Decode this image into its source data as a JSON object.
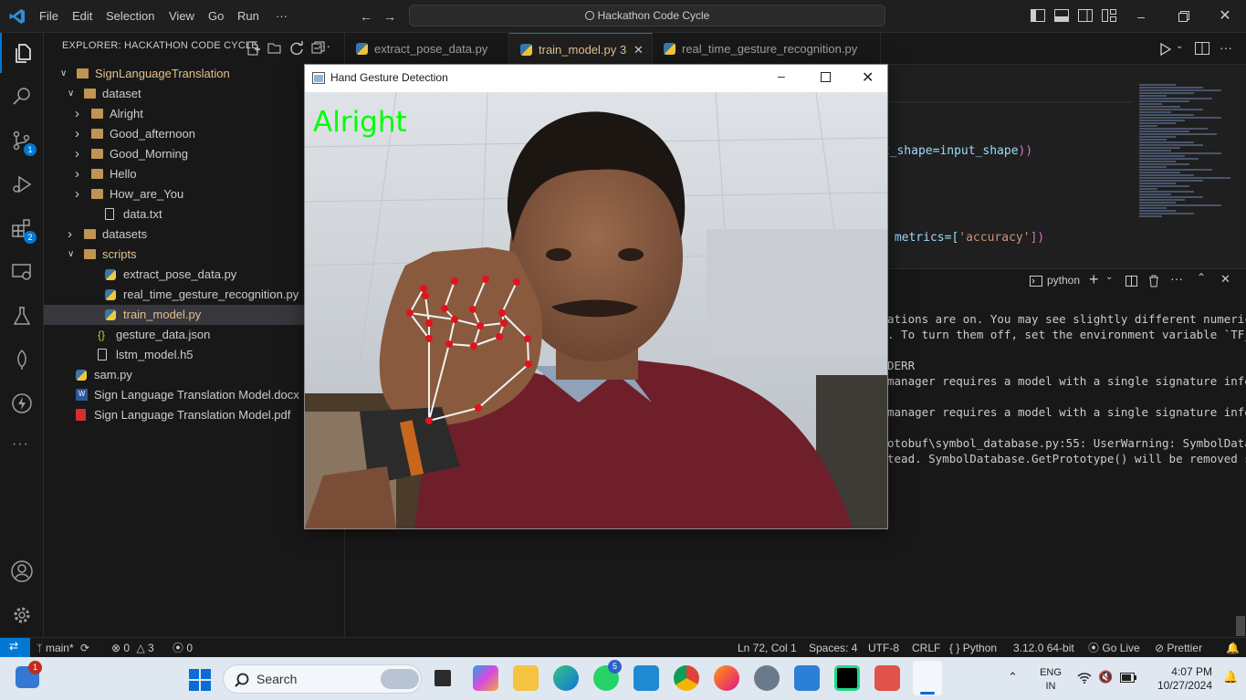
{
  "titlebar": {
    "menus": [
      "File",
      "Edit",
      "Selection",
      "View",
      "Go",
      "Run",
      "···"
    ],
    "command_center": "Hackathon Code Cycle"
  },
  "activitybar": {
    "scm_badge": "1",
    "extensions_badge": "2"
  },
  "sidebar": {
    "title": "EXPLORER: HACKATHON CODE CYCLE",
    "items": [
      {
        "label": "SignLanguageTranslation",
        "kind": "folder-open"
      },
      {
        "label": "dataset",
        "kind": "folder-open"
      },
      {
        "label": "Alright",
        "kind": "folder"
      },
      {
        "label": "Good_afternoon",
        "kind": "folder"
      },
      {
        "label": "Good_Morning",
        "kind": "folder"
      },
      {
        "label": "Hello",
        "kind": "folder"
      },
      {
        "label": "How_are_You",
        "kind": "folder"
      },
      {
        "label": "data.txt",
        "kind": "txt"
      },
      {
        "label": "datasets",
        "kind": "folder"
      },
      {
        "label": "scripts",
        "kind": "folder-open"
      },
      {
        "label": "extract_pose_data.py",
        "kind": "py"
      },
      {
        "label": "real_time_gesture_recognition.py",
        "kind": "py"
      },
      {
        "label": "train_model.py",
        "kind": "py"
      },
      {
        "label": "gesture_data.json",
        "kind": "json"
      },
      {
        "label": "lstm_model.h5",
        "kind": "txt"
      },
      {
        "label": "sam.py",
        "kind": "py"
      },
      {
        "label": "Sign Language Translation Model.docx",
        "kind": "docx"
      },
      {
        "label": "Sign Language Translation Model.pdf",
        "kind": "pdf"
      }
    ]
  },
  "tabs": [
    {
      "label": "extract_pose_data.py",
      "active": false
    },
    {
      "label": "train_model.py",
      "active": true,
      "problems": "3"
    },
    {
      "label": "real_time_gesture_recognition.py",
      "active": false
    }
  ],
  "editor": {
    "line1_a": "ut_shape=input_shape",
    "line1_b": "))",
    "line2_a": " metrics=[",
    "line2_b": "'accuracy'",
    "line2_c": "])"
  },
  "panel": {
    "terminal_name": "python",
    "lines": [
      "ations are on. You may see slightly different numerica",
      ". To turn them off, set the environment variable `TF_E",
      "",
      "DERR",
      "manager requires a model with a single signature infer",
      "",
      "manager requires a model with a single signature infer",
      "",
      "otobuf\\symbol_database.py:55: UserWarning: SymbolDatab",
      "tead. SymbolDatabase.GetPrototype() will be removed so"
    ]
  },
  "statusbar": {
    "branch": "main*",
    "errors": "0",
    "warnings": "3",
    "ports": "0",
    "position": "Ln 72, Col 1",
    "spaces": "Spaces: 4",
    "encoding": "UTF-8",
    "eol": "CRLF",
    "language": "Python",
    "interpreter": "3.12.0 64-bit",
    "golive": "Go Live",
    "prettier": "Prettier"
  },
  "cv_window": {
    "title": "Hand Gesture Detection",
    "prediction": "Alright"
  },
  "taskbar": {
    "search_placeholder": "Search",
    "widgets_badge": "1",
    "whatsapp_badge": "5",
    "lang_line1": "ENG",
    "lang_line2": "IN",
    "time": "4:07 PM",
    "date": "10/27/2024"
  }
}
